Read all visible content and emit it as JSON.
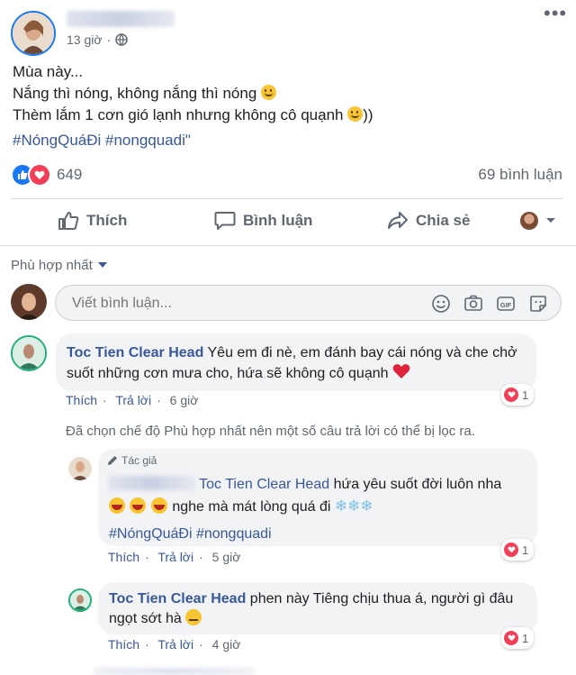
{
  "post": {
    "time": "13 giờ",
    "lines": [
      "Mùa này...",
      "Nắng thì nóng, không nắng thì nóng",
      "Thèm lắm 1 cơn gió lạnh nhưng không cô quạnh",
      "))"
    ],
    "hashtags": "#NóngQuáĐi #nongquadi\""
  },
  "stats": {
    "reactions_count": "649",
    "comments_count": "69 bình luận"
  },
  "actions": {
    "like": "Thích",
    "comment": "Bình luận",
    "share": "Chia sẻ"
  },
  "sort": {
    "label": "Phù hợp nhất"
  },
  "composer": {
    "placeholder": "Viết bình luận..."
  },
  "comments": [
    {
      "author": "Toc Tien Clear Head",
      "text": "Yêu em đi nè, em đánh bay cái nóng và che chở suốt những cơn mưa cho, hứa sẽ không cô quạnh",
      "like": "Thích",
      "reply": "Trả lời",
      "time": "6 giờ",
      "reactions": "1"
    }
  ],
  "filter_notice": "Đã chọn chế độ Phù hợp nhất nên một số câu trả lời có thể bị lọc ra.",
  "replies": [
    {
      "badge": "Tác giả",
      "tag": "Toc Tien Clear Head",
      "text": "hứa yêu suốt đời luôn nha",
      "text2": "nghe mà mát lòng quá đi",
      "hashtags": "#NóngQuáĐi #nongquadi",
      "like": "Thích",
      "reply": "Trả lời",
      "time": "5 giờ",
      "reactions": "1"
    },
    {
      "author": "Toc Tien Clear Head",
      "text": "phen này Tiêng chịu thua á, người gì đâu ngọt sớt hà",
      "like": "Thích",
      "reply": "Trả lời",
      "time": "4 giờ",
      "reactions": "1"
    }
  ],
  "colors": {
    "link": "#385898",
    "like_blue": "#1877f2",
    "love_red": "#f33e58",
    "muted": "#606770"
  }
}
